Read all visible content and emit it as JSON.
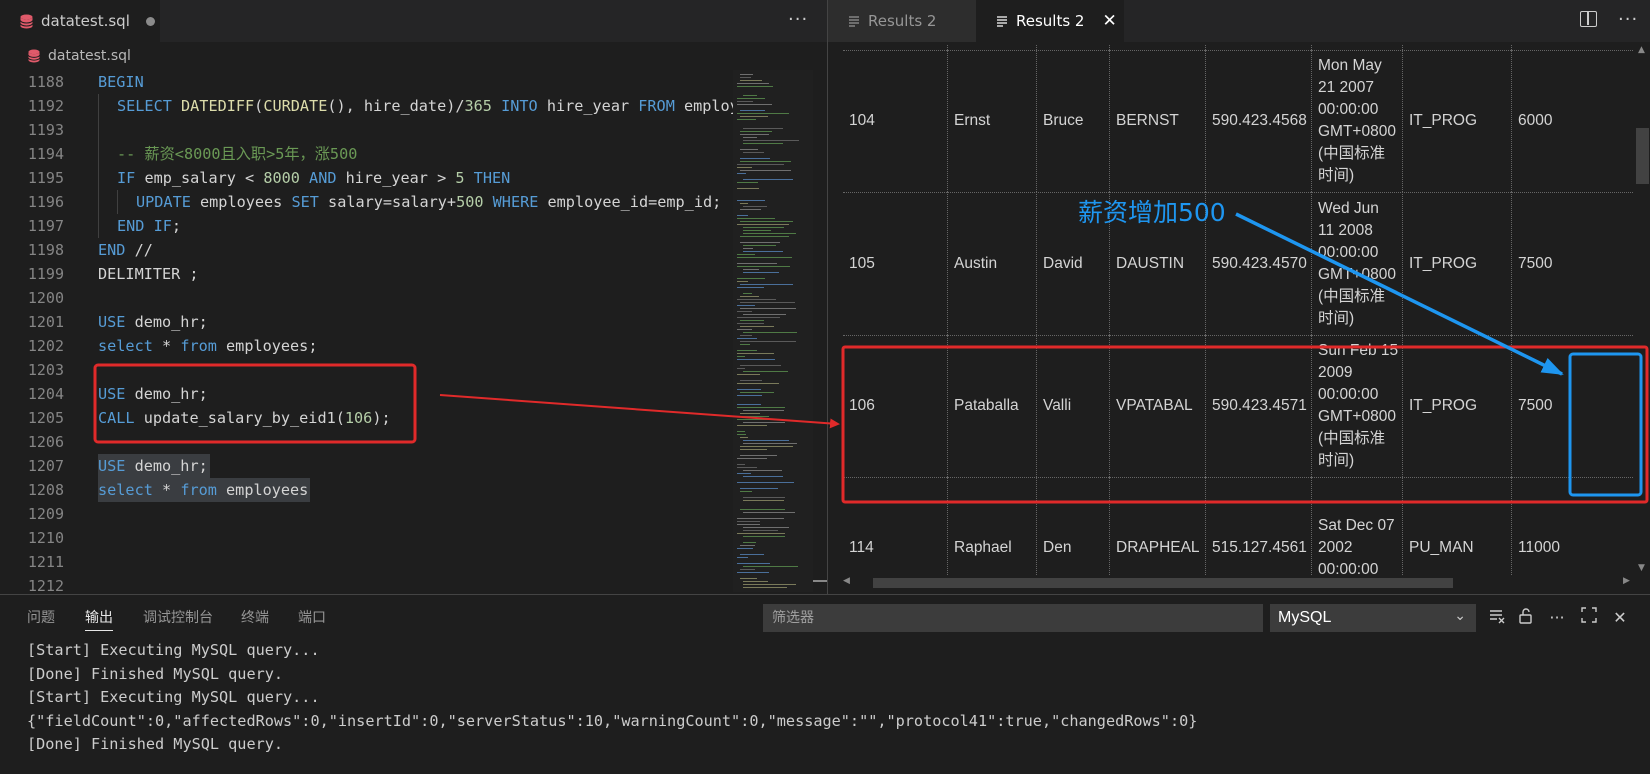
{
  "editor": {
    "tab_label": "datatest.sql",
    "breadcrumb": "datatest.sql",
    "lines": [
      {
        "n": "1188",
        "indent": 0,
        "tokens": [
          [
            "BEGIN",
            "kw"
          ]
        ]
      },
      {
        "n": "1192",
        "indent": 1,
        "tokens": [
          [
            "SELECT ",
            "kw"
          ],
          [
            "DATEDIFF",
            "fn"
          ],
          [
            "(",
            ""
          ],
          [
            "CURDATE",
            "fn"
          ],
          [
            "(), hire_date)/",
            ""
          ],
          [
            "365",
            "num"
          ],
          [
            " ",
            ""
          ],
          [
            "INTO",
            "kw"
          ],
          [
            " hire_year ",
            ""
          ],
          [
            "FROM",
            "kw"
          ],
          [
            " employees",
            ""
          ]
        ]
      },
      {
        "n": "1193",
        "indent": 0,
        "tokens": []
      },
      {
        "n": "1194",
        "indent": 1,
        "tokens": [
          [
            "-- 薪资<8000且入职>5年，涨500",
            "cm"
          ]
        ]
      },
      {
        "n": "1195",
        "indent": 1,
        "tokens": [
          [
            "IF",
            "kw"
          ],
          [
            " emp_salary < ",
            ""
          ],
          [
            "8000",
            "num"
          ],
          [
            " ",
            ""
          ],
          [
            "AND",
            "kw"
          ],
          [
            " hire_year > ",
            ""
          ],
          [
            "5",
            "num"
          ],
          [
            " ",
            ""
          ],
          [
            "THEN",
            "kw"
          ]
        ]
      },
      {
        "n": "1196",
        "indent": 2,
        "tokens": [
          [
            "UPDATE",
            "kw"
          ],
          [
            " employees ",
            ""
          ],
          [
            "SET",
            "kw"
          ],
          [
            " salary=salary+",
            ""
          ],
          [
            "500",
            "num"
          ],
          [
            " ",
            ""
          ],
          [
            "WHERE",
            "kw"
          ],
          [
            " employee_id=emp_id;",
            ""
          ]
        ]
      },
      {
        "n": "1197",
        "indent": 1,
        "tokens": [
          [
            "END IF",
            "kw"
          ],
          [
            ";",
            ""
          ]
        ]
      },
      {
        "n": "1198",
        "indent": 0,
        "tokens": [
          [
            "END",
            "kw"
          ],
          [
            " //",
            ""
          ]
        ]
      },
      {
        "n": "1199",
        "indent": 0,
        "tokens": [
          [
            "DELIMITER ;",
            ""
          ]
        ]
      },
      {
        "n": "1200",
        "indent": 0,
        "tokens": []
      },
      {
        "n": "1201",
        "indent": 0,
        "tokens": [
          [
            "USE",
            "kw"
          ],
          [
            " demo_hr;",
            ""
          ]
        ]
      },
      {
        "n": "1202",
        "indent": 0,
        "tokens": [
          [
            "select",
            "kw"
          ],
          [
            " * ",
            ""
          ],
          [
            "from",
            "kw"
          ],
          [
            " employees;",
            ""
          ]
        ]
      },
      {
        "n": "1203",
        "indent": 0,
        "tokens": []
      },
      {
        "n": "1204",
        "indent": 0,
        "tokens": [
          [
            "USE",
            "kw"
          ],
          [
            " demo_hr;",
            ""
          ]
        ]
      },
      {
        "n": "1205",
        "indent": 0,
        "tokens": [
          [
            "CALL",
            "kw"
          ],
          [
            " update_salary_by_eid1(",
            ""
          ],
          [
            "106",
            "num"
          ],
          [
            ");",
            ""
          ]
        ]
      },
      {
        "n": "1206",
        "indent": 0,
        "tokens": []
      },
      {
        "n": "1207",
        "indent": 0,
        "tokens": [
          [
            "USE",
            "kw"
          ],
          [
            " demo_hr;",
            ""
          ]
        ]
      },
      {
        "n": "1208",
        "indent": 0,
        "tokens": [
          [
            "select",
            "kw"
          ],
          [
            " * ",
            ""
          ],
          [
            "from",
            "kw"
          ],
          [
            " employees",
            ""
          ]
        ]
      },
      {
        "n": "1209",
        "indent": 0,
        "tokens": []
      },
      {
        "n": "1210",
        "indent": 0,
        "tokens": []
      },
      {
        "n": "1211",
        "indent": 0,
        "tokens": []
      },
      {
        "n": "1212",
        "indent": 0,
        "tokens": []
      }
    ]
  },
  "results": {
    "tabs": [
      {
        "label": "Results 2",
        "active": false
      },
      {
        "label": "Results 2",
        "active": true
      }
    ],
    "rows": [
      {
        "cells": [
          "",
          "",
          "",
          "",
          "",
          "",
          "",
          ""
        ]
      },
      {
        "cells": [
          "104",
          "Ernst",
          "Bruce",
          "BERNST",
          "590.423.4568",
          "Mon May\n21 2007\n00:00:00\nGMT+0800\n(中国标准\n时间)",
          "IT_PROG",
          "6000"
        ]
      },
      {
        "cells": [
          "105",
          "Austin",
          "David",
          "DAUSTIN",
          "590.423.4570",
          "Wed Jun\n11 2008\n00:00:00\nGMT+0800\n(中国标准\n时间)",
          "IT_PROG",
          "7500"
        ]
      },
      {
        "cells": [
          "106",
          "Pataballa",
          "Valli",
          "VPATABAL",
          "590.423.4571",
          "Sun Feb 15\n2009\n00:00:00\nGMT+0800\n(中国标准\n时间)",
          "IT_PROG",
          "7500"
        ]
      },
      {
        "cells": [
          "114",
          "Raphael",
          "Den",
          "DRAPHEAL",
          "515.127.4561",
          "Sat Dec 07\n2002\n00:00:00",
          "PU_MAN",
          "11000"
        ]
      }
    ],
    "annotation_label": "薪资增加500"
  },
  "panel": {
    "tabs": [
      "问题",
      "输出",
      "调试控制台",
      "终端",
      "端口"
    ],
    "active_tab": "输出",
    "filter_placeholder": "筛选器",
    "channel": "MySQL",
    "output_lines": [
      "[Start] Executing MySQL query...",
      "[Done] Finished MySQL query.",
      "[Start] Executing MySQL query...",
      "{\"fieldCount\":0,\"affectedRows\":0,\"insertId\":0,\"serverStatus\":10,\"warningCount\":0,\"message\":\"\",\"protocol41\":true,\"changedRows\":0}",
      "[Done] Finished MySQL query."
    ]
  },
  "colors": {
    "annotation_red": "#e02a2a",
    "annotation_blue": "#1e96f0",
    "keyword": "#569cd6",
    "number": "#b5cea8",
    "comment": "#6a9955",
    "function": "#dcdcaa"
  }
}
